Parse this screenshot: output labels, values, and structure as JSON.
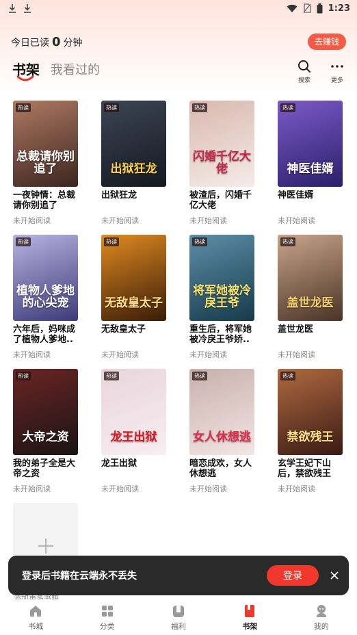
{
  "status_bar": {
    "time": "1:23"
  },
  "header": {
    "read_prefix": "今日已读",
    "read_minutes": "0",
    "read_suffix": "分钟",
    "earn_button": "去赚钱"
  },
  "tabs": {
    "active": "书架",
    "inactive": "我看过的",
    "search_label": "搜索",
    "more_label": "更多"
  },
  "books": [
    {
      "title": "一夜钟情：总裁请你别追了",
      "status": "未开始阅读",
      "tag": "热读",
      "cover_text": "总裁请你别追了",
      "colors": [
        "#3b2520",
        "#b07a62"
      ],
      "text_color": "#ffffff"
    },
    {
      "title": "出狱狂龙",
      "status": "未开始阅读",
      "tag": "热读",
      "cover_text": "出狱狂龙",
      "colors": [
        "#141820",
        "#3c4554"
      ],
      "text_color": "#ffd24a"
    },
    {
      "title": "被渣后，闪婚千亿大佬",
      "status": "未开始阅读",
      "tag": "热读",
      "cover_text": "闪婚千亿大佬",
      "colors": [
        "#f5ece8",
        "#d9b8ae"
      ],
      "text_color": "#c62848"
    },
    {
      "title": "神医佳婿",
      "status": "未开始阅读",
      "tag": "热读",
      "cover_text": "神医佳婿",
      "colors": [
        "#2a1f6a",
        "#7c5ac8"
      ],
      "text_color": "#ffffff"
    },
    {
      "title": "六年后，妈咪成了植物人爹地..",
      "status": "未开始阅读",
      "tag": "热读",
      "cover_text": "植物人爹地的心尖宠",
      "colors": [
        "#3e3a7a",
        "#b7b3e0"
      ],
      "text_color": "#ffffff"
    },
    {
      "title": "无敌皇太子",
      "status": "未开始阅读",
      "tag": "热读",
      "cover_text": "无敌皇太子",
      "colors": [
        "#3a1c08",
        "#e08a20"
      ],
      "text_color": "#ffe08a"
    },
    {
      "title": "重生后，将军她被冷戾王爷娇..",
      "status": "未开始阅读",
      "tag": "热读",
      "cover_text": "将军她被冷戾王爷",
      "colors": [
        "#163a4a",
        "#5d8fa8"
      ],
      "text_color": "#f8e26a"
    },
    {
      "title": "盖世龙医",
      "status": "未开始阅读",
      "tag": "热读",
      "cover_text": "盖世龙医",
      "colors": [
        "#4a3426",
        "#c9a48a"
      ],
      "text_color": "#f5d070"
    },
    {
      "title": "我的弟子全是大帝之资",
      "status": "未开始阅读",
      "tag": "热读",
      "cover_text": "大帝之资",
      "colors": [
        "#1a1414",
        "#6a2424"
      ],
      "text_color": "#ffffff"
    },
    {
      "title": "龙王出狱",
      "status": "未开始阅读",
      "tag": "热读",
      "cover_text": "龙王出狱",
      "colors": [
        "#f7eef0",
        "#e8d5dc"
      ],
      "text_color": "#d61c24"
    },
    {
      "title": "暗恋成欢，女人休想逃",
      "status": "未开始阅读",
      "tag": "热读",
      "cover_text": "女人休想逃",
      "colors": [
        "#f2e6e4",
        "#c9b0ac"
      ],
      "text_color": "#e02a4a"
    },
    {
      "title": "玄学王妃下山后，禁欲残王宠..",
      "status": "未开始阅读",
      "tag": "热读",
      "cover_text": "禁欲残王",
      "colors": [
        "#3a1a14",
        "#b06a40"
      ],
      "text_color": "#ffe28a"
    }
  ],
  "toast": {
    "message": "登录后书籍在云端永不丢失",
    "login_button": "登录"
  },
  "behind_text": "添加更多书籍",
  "bottom_nav": [
    {
      "label": "书城",
      "icon": "home-icon",
      "active": false
    },
    {
      "label": "分类",
      "icon": "grid-icon",
      "active": false
    },
    {
      "label": "福利",
      "icon": "gift-icon",
      "active": false
    },
    {
      "label": "书架",
      "icon": "bookshelf-icon",
      "active": true
    },
    {
      "label": "我的",
      "icon": "profile-icon",
      "active": false
    }
  ],
  "accent_color": "#f0392c"
}
